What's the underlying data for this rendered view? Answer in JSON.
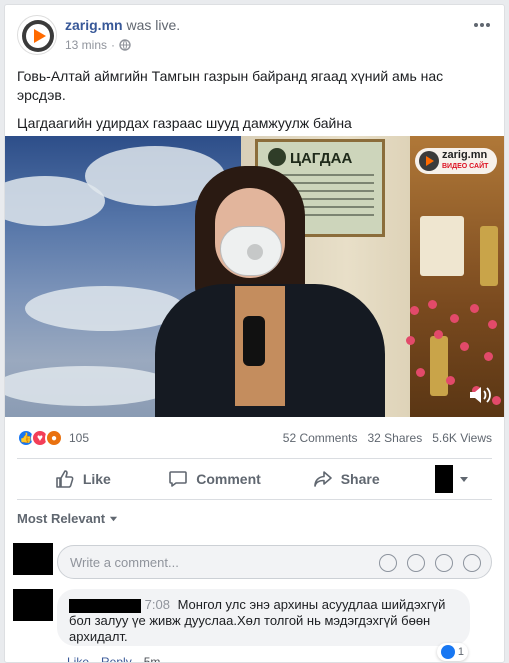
{
  "post": {
    "author": "zarig.mn",
    "action": "was live.",
    "time": "13 mins",
    "privacy_icon": "globe-icon",
    "paragraphs": [
      "Говь-Алтай аймгийн Тамгын газрын байранд ягаад хүний амь нас эрсдэв.",
      "Цагдаагийн удирдах газраас шууд дамжуулж байна"
    ]
  },
  "video": {
    "sign_title": "ЦАГДАА",
    "badge_title": "zarig.mn",
    "badge_subtitle": "ВИДЕО САЙТ",
    "volume_icon": "volume-icon"
  },
  "stats": {
    "reaction_count": "105",
    "comments": "52 Comments",
    "shares": "32 Shares",
    "views": "5.6K Views"
  },
  "actions": {
    "like": "Like",
    "comment": "Comment",
    "share": "Share"
  },
  "comments": {
    "sort_label": "Most Relevant",
    "write_placeholder": "Write a comment...",
    "items": [
      {
        "time": "7:08",
        "text": "Монгол улс энэ архины асуудлаа шийдэхгүй бол залуу үе живж дууслаа.Хөл толгой нь мэдэгдэхгүй бөөн архидалт.",
        "like": "Like",
        "reply": "Reply",
        "age": "5m",
        "like_count": "1"
      }
    ]
  }
}
